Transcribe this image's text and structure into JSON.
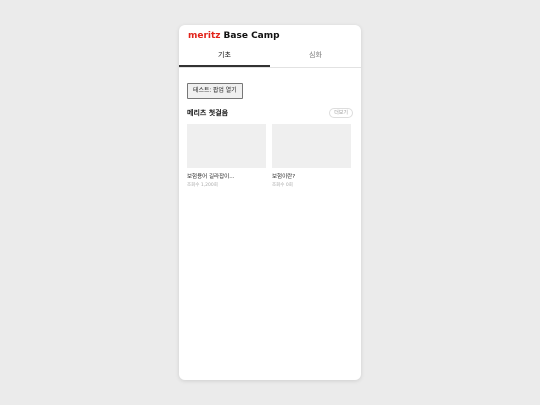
{
  "header": {
    "brand": "meritz",
    "title": "Base Camp"
  },
  "tabs": [
    {
      "label": "기초",
      "active": true
    },
    {
      "label": "심화",
      "active": false
    }
  ],
  "popup_button": {
    "label": "테스트: 팝업 열기"
  },
  "section": {
    "title": "메리츠 첫걸음",
    "more_label": "더보기",
    "items": [
      {
        "title": "보험용어 길라잡이...",
        "views": "조회수 1,200회"
      },
      {
        "title": "보험이란?",
        "views": "조회수 0회"
      }
    ]
  },
  "colors": {
    "brand": "#e2231a",
    "background": "#ebebeb",
    "card": "#ffffff",
    "thumbnail": "#efefef"
  }
}
